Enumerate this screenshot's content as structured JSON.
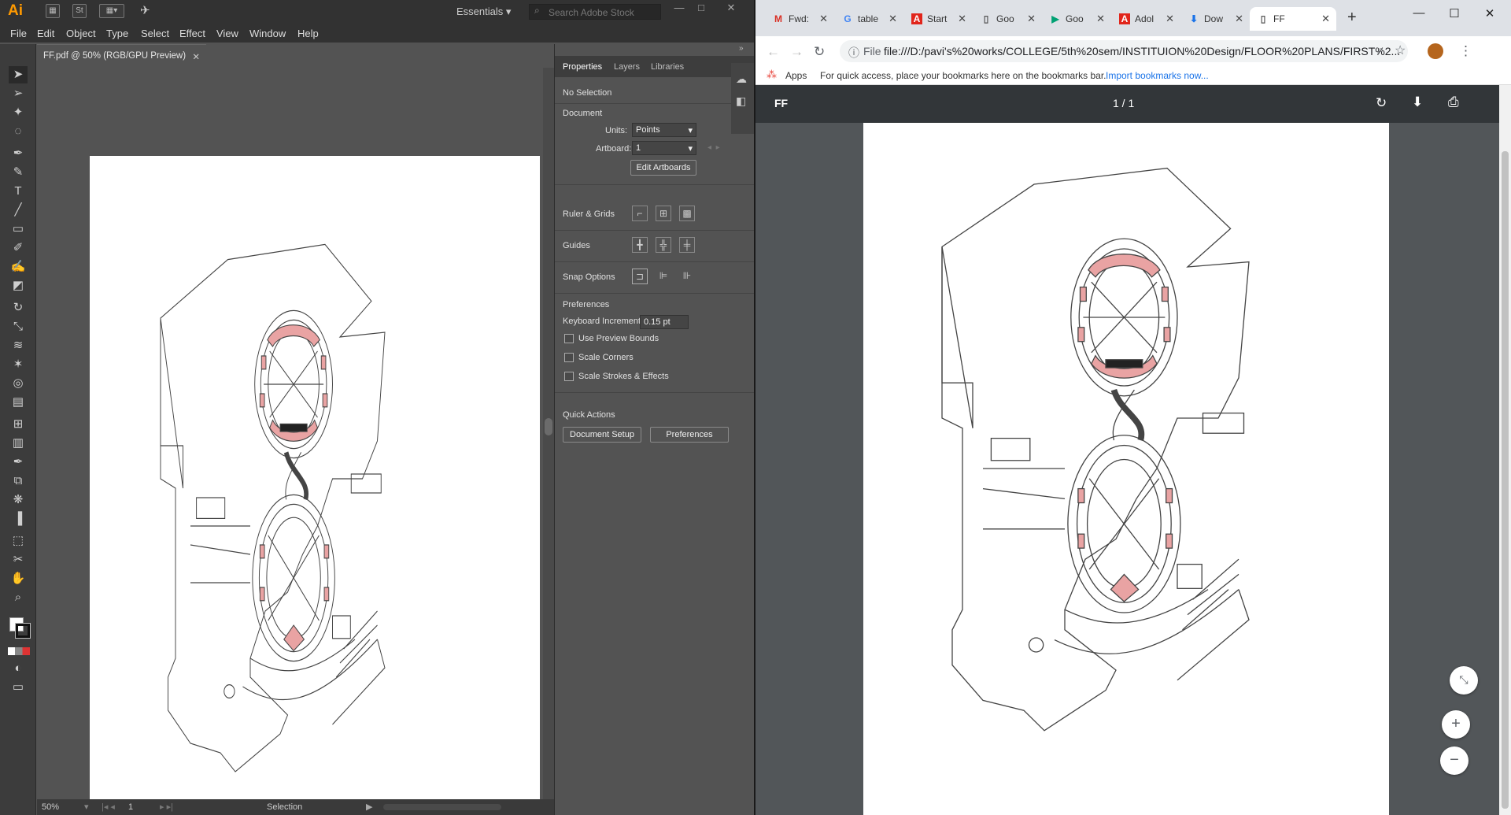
{
  "illustrator": {
    "logo": "Ai",
    "titlebar": {
      "st_label": "St",
      "workspace": "Essentials",
      "search_placeholder": "Search Adobe Stock"
    },
    "menu": [
      "File",
      "Edit",
      "Object",
      "Type",
      "Select",
      "Effect",
      "View",
      "Window",
      "Help"
    ],
    "document_tab": "FF.pdf @ 50% (RGB/GPU Preview)",
    "panel": {
      "tabs": [
        "Properties",
        "Layers",
        "Libraries"
      ],
      "selection": "No Selection",
      "document_heading": "Document",
      "units_label": "Units:",
      "units_value": "Points",
      "artboard_label": "Artboard:",
      "artboard_value": "1",
      "edit_artboards": "Edit Artboards",
      "ruler_grids": "Ruler & Grids",
      "guides": "Guides",
      "snap_options": "Snap Options",
      "preferences_heading": "Preferences",
      "keyboard_increment_label": "Keyboard Increment:",
      "keyboard_increment_value": "0.15 pt",
      "use_preview_bounds": "Use Preview Bounds",
      "scale_corners": "Scale Corners",
      "scale_strokes": "Scale Strokes & Effects",
      "quick_actions": "Quick Actions",
      "document_setup": "Document Setup",
      "preferences_button": "Preferences"
    },
    "status": {
      "zoom": "50%",
      "artboard": "1",
      "tool": "Selection"
    }
  },
  "chrome": {
    "tabs": [
      {
        "label": "Fwd:",
        "icon": "gmail-icon"
      },
      {
        "label": "table",
        "icon": "google-icon"
      },
      {
        "label": "Start",
        "icon": "adobe-icon"
      },
      {
        "label": "Goo",
        "icon": "doc-icon"
      },
      {
        "label": "Goo",
        "icon": "play-icon"
      },
      {
        "label": "Adol",
        "icon": "adobe-icon"
      },
      {
        "label": "Dow",
        "icon": "download-icon"
      },
      {
        "label": "FF",
        "icon": "doc-icon"
      }
    ],
    "address_prefix": "File",
    "url": "file:///D:/pavi's%20works/COLLEGE/5th%20sem/INSTITUION%20Design/FLOOR%20PLANS/FIRST%2...",
    "bookmarks": {
      "apps": "Apps",
      "message": "For quick access, place your bookmarks here on the bookmarks bar.",
      "link": "Import bookmarks now..."
    },
    "pdf": {
      "title": "FF",
      "page_indicator": "1 / 1"
    }
  },
  "colors": {
    "ai_orange": "#ff9a00",
    "highlight_pink": "#e9a3a3",
    "chrome_link": "#1a73e8"
  }
}
